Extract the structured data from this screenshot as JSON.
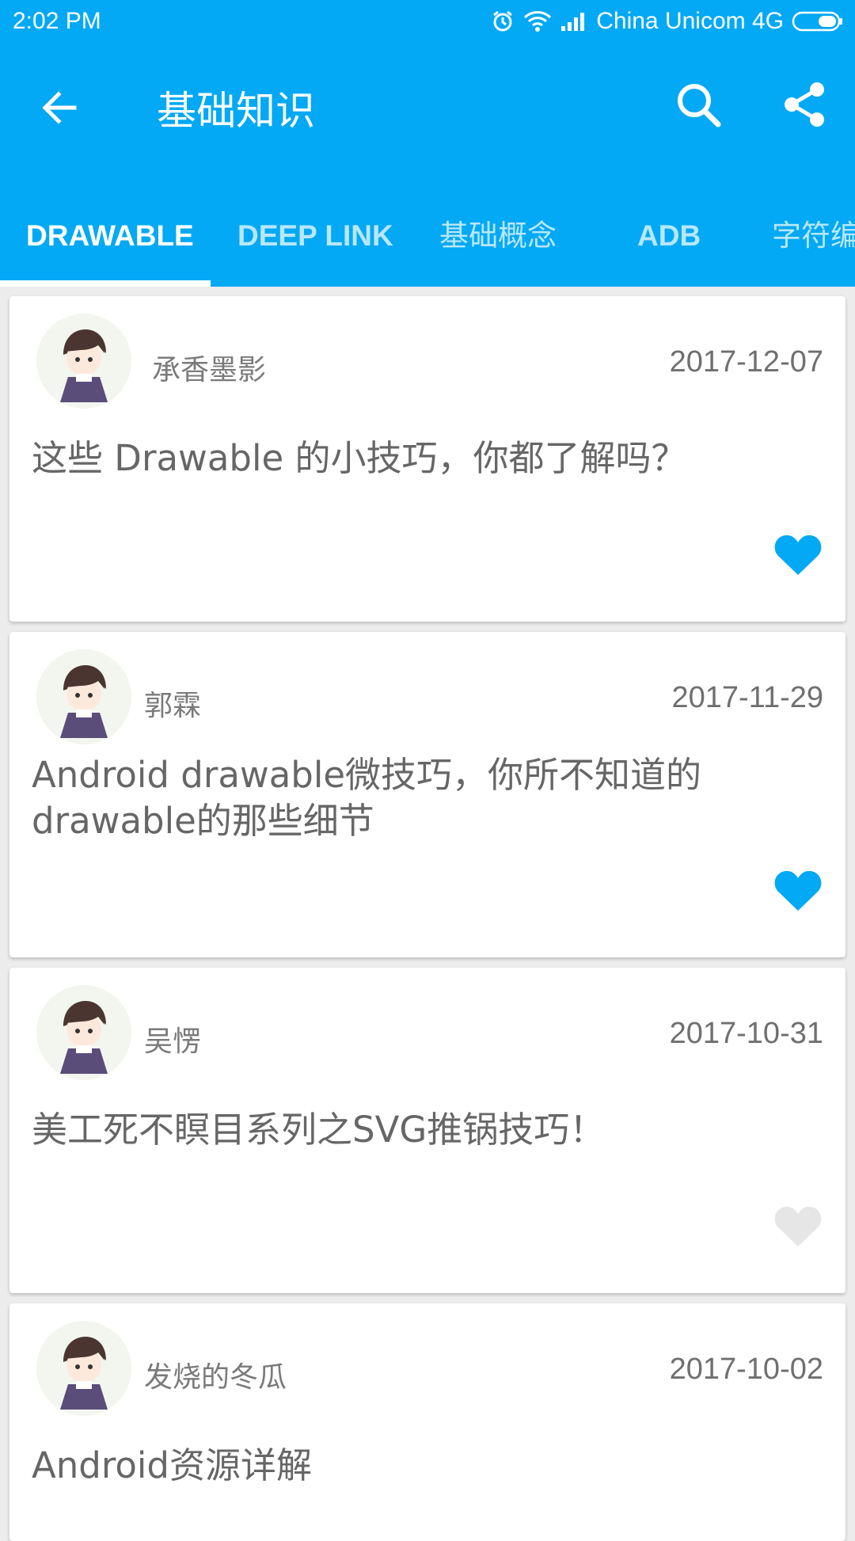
{
  "status_bar": {
    "time": "2:02 PM",
    "carrier": "China Unicom 4G"
  },
  "toolbar": {
    "title": "基础知识",
    "back_icon": "arrow-back-icon",
    "search_icon": "search-icon",
    "share_icon": "share-icon"
  },
  "tabs": [
    {
      "label": "DRAWABLE",
      "active": true
    },
    {
      "label": "DEEP LINK",
      "active": false
    },
    {
      "label": "基础概念",
      "active": false
    },
    {
      "label": "ADB",
      "active": false
    },
    {
      "label": "字符编",
      "active": false
    }
  ],
  "posts": [
    {
      "author": "承香墨影",
      "date": "2017-12-07",
      "title": "这些 Drawable 的小技巧，你都了解吗？",
      "liked": true
    },
    {
      "author": "郭霖",
      "date": "2017-11-29",
      "title": "Android drawable微技巧，你所不知道的drawable的那些细节",
      "liked": true
    },
    {
      "author": "吴愣",
      "date": "2017-10-31",
      "title": "美工死不瞑目系列之SVG推锅技巧！",
      "liked": false
    },
    {
      "author": "发烧的冬瓜",
      "date": "2017-10-02",
      "title": "Android资源详解",
      "liked": false
    }
  ],
  "colors": {
    "primary": "#03a9f4",
    "like_active": "#03a9f4",
    "like_inactive": "#e6e6e6"
  }
}
